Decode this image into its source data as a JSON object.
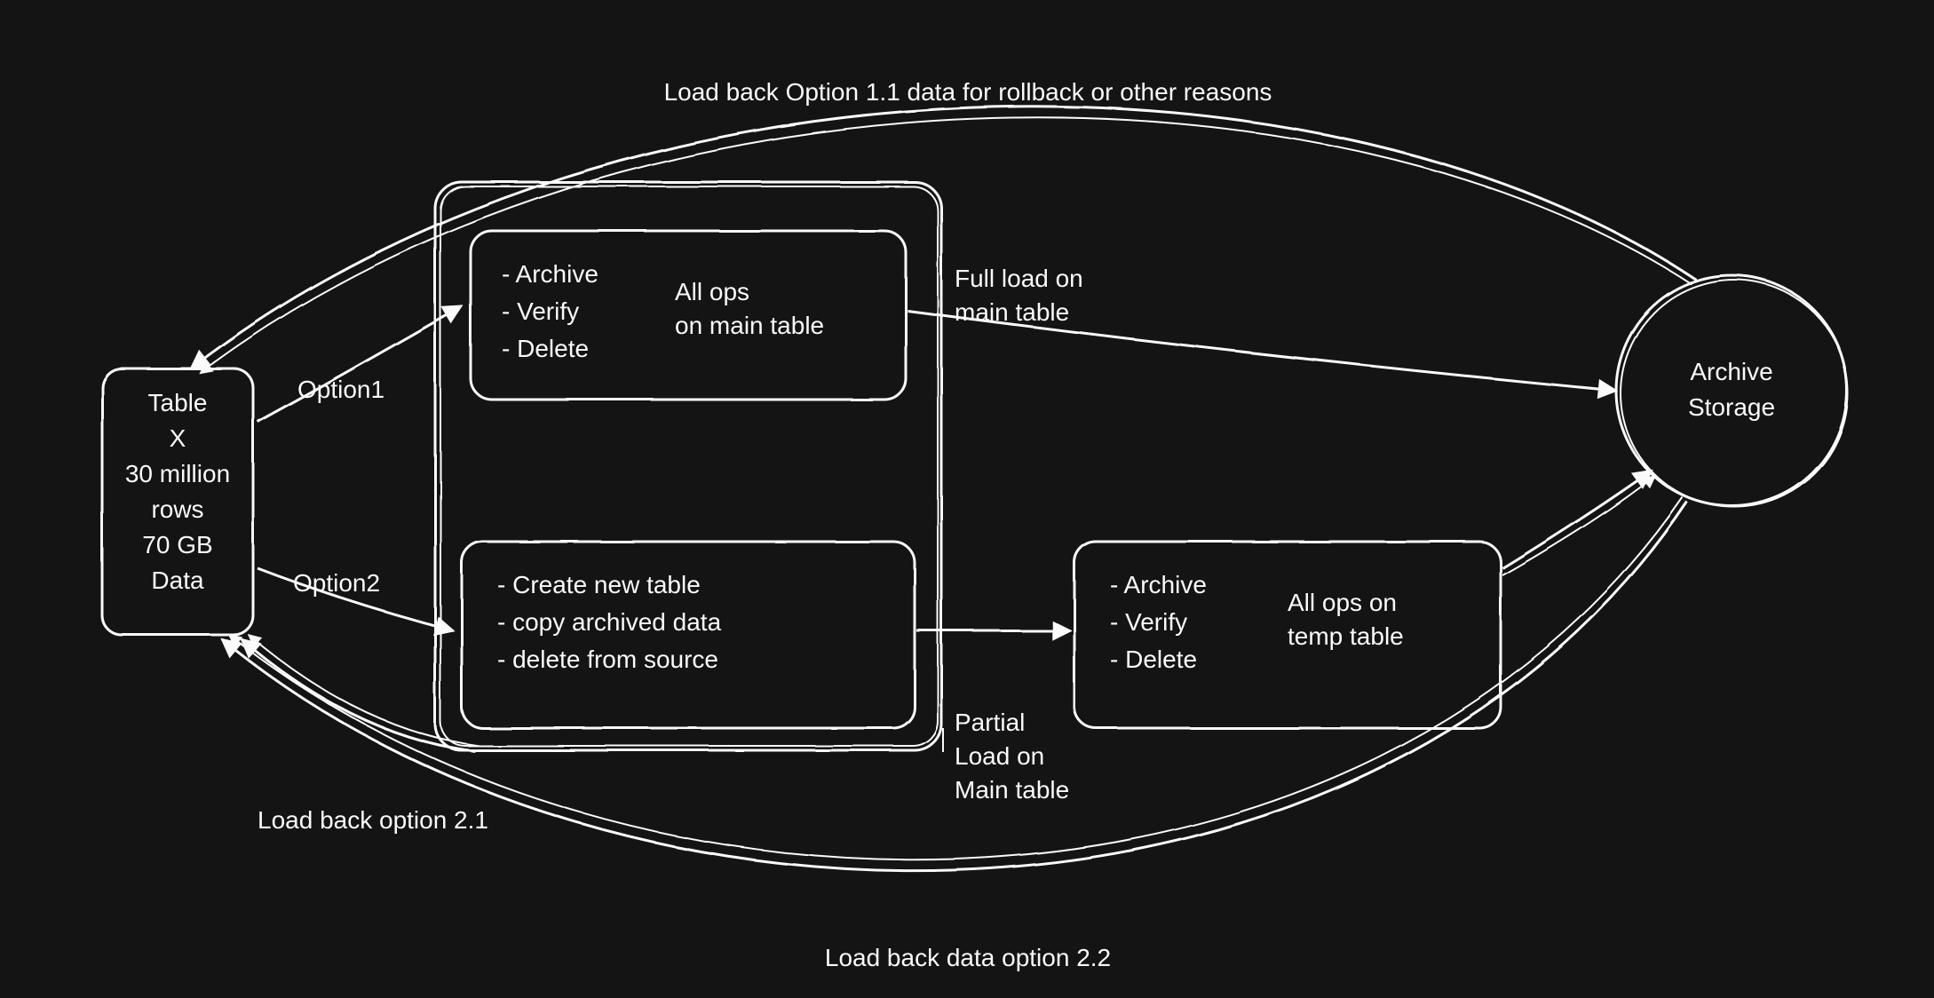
{
  "top_label": "Load back Option 1.1 data for rollback or other reasons",
  "source": {
    "l1": "Table",
    "l2": "X",
    "l3": "30 million",
    "l4": "rows",
    "l5": "70 GB",
    "l6": "Data"
  },
  "option1_label": "Option1",
  "option2_label": "Option2",
  "option1_box": {
    "b1": "- Archive",
    "b2": "- Verify",
    "b3": "- Delete",
    "side1": "All ops",
    "side2": "on main table"
  },
  "full_load": {
    "l1": "Full load on",
    "l2": "main table"
  },
  "option2_box": {
    "b1": "- Create new table",
    "b2": "- copy archived data",
    "b3": "- delete from source"
  },
  "temp_box": {
    "b1": "- Archive",
    "b2": "- Verify",
    "b3": "- Delete",
    "side1": "All ops on",
    "side2": "temp table"
  },
  "partial_load": {
    "l1": "Partial",
    "l2": "Load on",
    "l3": "Main table"
  },
  "archive_storage": {
    "l1": "Archive",
    "l2": "Storage"
  },
  "loadback21": "Load back option 2.1",
  "loadback22": "Load back data option 2.2"
}
